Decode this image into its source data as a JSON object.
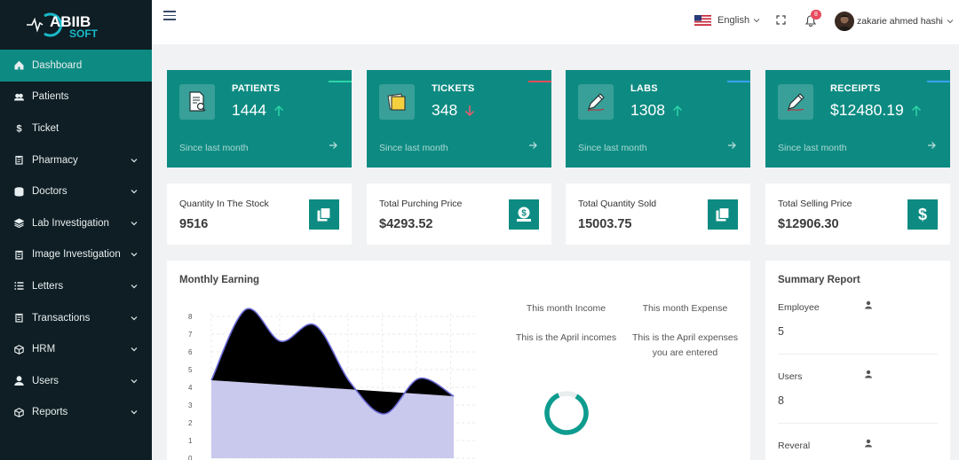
{
  "brand": {
    "line1": "ABIIB",
    "line2": "SOFT"
  },
  "sidebar": {
    "items": [
      {
        "label": "Dashboard",
        "icon": "home-icon",
        "active": true,
        "expandable": false
      },
      {
        "label": "Patients",
        "icon": "users-icon",
        "active": false,
        "expandable": false
      },
      {
        "label": "Ticket",
        "icon": "dollar-icon",
        "active": false,
        "expandable": false
      },
      {
        "label": "Pharmacy",
        "icon": "clipboard-icon",
        "active": false,
        "expandable": true
      },
      {
        "label": "Doctors",
        "icon": "database-icon",
        "active": false,
        "expandable": true
      },
      {
        "label": "Lab Investigation",
        "icon": "layers-icon",
        "active": false,
        "expandable": true
      },
      {
        "label": "Image Investigation",
        "icon": "clipboard-icon",
        "active": false,
        "expandable": true
      },
      {
        "label": "Letters",
        "icon": "list-icon",
        "active": false,
        "expandable": true
      },
      {
        "label": "Transactions",
        "icon": "clipboard-icon",
        "active": false,
        "expandable": true
      },
      {
        "label": "HRM",
        "icon": "box-icon",
        "active": false,
        "expandable": true
      },
      {
        "label": "Users",
        "icon": "user-icon",
        "active": false,
        "expandable": true
      },
      {
        "label": "Reports",
        "icon": "box-icon",
        "active": false,
        "expandable": true
      }
    ]
  },
  "header": {
    "language": "English",
    "notification_count": "8",
    "user_name": "zakarie ahmed hashi"
  },
  "stats": [
    {
      "title": "PATIENTS",
      "value": "1444",
      "trend": "up",
      "since": "Since last month",
      "accent": "#2dd4a8"
    },
    {
      "title": "TICKETS",
      "value": "348",
      "trend": "down",
      "since": "Since last month",
      "accent": "#e74c5e"
    },
    {
      "title": "LABS",
      "value": "1308",
      "trend": "up",
      "since": "Since last month",
      "accent": "#3aa0f0"
    },
    {
      "title": "RECEIPTS",
      "value": "$12480.19",
      "trend": "up",
      "since": "Since last month",
      "accent": "#3aa0f0"
    }
  ],
  "info_cards": [
    {
      "label": "Quantity In The Stock",
      "value": "9516",
      "icon": "copy-icon"
    },
    {
      "label": "Total Purching Price",
      "value": "$4293.52",
      "icon": "money-icon"
    },
    {
      "label": "Total Quantity Sold",
      "value": "15003.75",
      "icon": "copy-icon"
    },
    {
      "label": "Total Selling Price",
      "value": "$12906.30",
      "icon": "dollar-icon"
    }
  ],
  "earning": {
    "title": "Monthly Earning",
    "income_heading": "This month Income",
    "income_text": "This is the April incomes",
    "expense_heading": "This month Expense",
    "expense_text_1": "This is the April expenses",
    "expense_text_2": "you are entered"
  },
  "chart_data": {
    "type": "area",
    "x": [
      0,
      1,
      2,
      3,
      4,
      5,
      6,
      7
    ],
    "series": [
      {
        "values": [
          4.4,
          8.4,
          6.6,
          7.5,
          4.3,
          2.5,
          4.5,
          3.5
        ],
        "color": "#000000"
      },
      {
        "values": [
          4.4,
          4.25,
          4.1,
          3.95,
          3.8,
          3.7,
          3.6,
          3.5
        ],
        "color": "#c9c9ee"
      }
    ],
    "yticks": [
      "0",
      "1",
      "2",
      "3",
      "4",
      "5",
      "6",
      "7",
      "8"
    ],
    "ylim": [
      0,
      9
    ]
  },
  "donut": {
    "fraction": 0.85,
    "color": "#0d9c8f",
    "track": "#e8eeee"
  },
  "summary": {
    "title": "Summary Report",
    "rows": [
      {
        "label": "Employee",
        "value": "5"
      },
      {
        "label": "Users",
        "value": "8"
      },
      {
        "label": "Reveral",
        "value": ""
      }
    ]
  }
}
